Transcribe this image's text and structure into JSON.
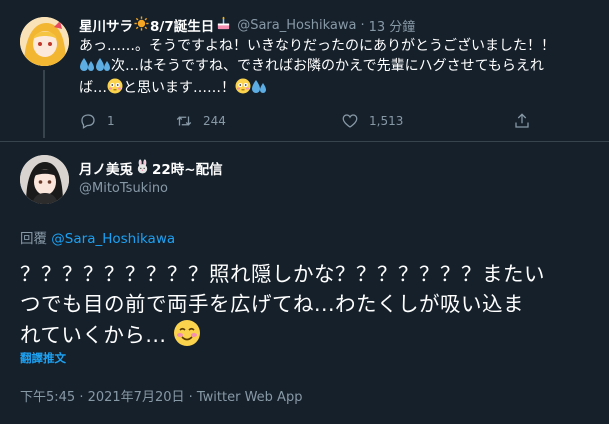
{
  "tweet1": {
    "display_name": "星川サラ",
    "name_suffix": "8/7誕生日",
    "handle": "@Sara_Hoshikawa",
    "time": "13 分鐘",
    "text_line1": "あっ……。そうですよね！いきなりだったのにありがとうございました！！",
    "text_line2_after_emoji": "次…はそうですね、できればお隣のかえで先輩にハグさせてもらえれ",
    "text_line3_start": "ば…",
    "text_line3_mid": "と思います……！",
    "actions": {
      "reply_count": "1",
      "retweet_count": "244",
      "like_count": "1,513"
    }
  },
  "tweet2": {
    "display_name": "月ノ美兎",
    "name_suffix": "22時~配信",
    "handle": "@MitoTsukino",
    "reply_prefix": "回覆",
    "reply_to": "@Sara_Hoshikawa",
    "text_line1": "？？？？？？？？？照れ隠しかな？？？？？？？またい",
    "text_line2": "つでも目の前で両手を広げてね...わたくしが吸い込ま",
    "text_line3": "れていくから...",
    "translate_label": "翻譯推文",
    "meta": "下午5:45 · 2021年7月20日 · Twitter Web App"
  },
  "colors": {
    "background": "#15202b",
    "text": "#ffffff",
    "muted": "#8899a6",
    "link": "#1da1f2",
    "divider": "#38444d"
  }
}
